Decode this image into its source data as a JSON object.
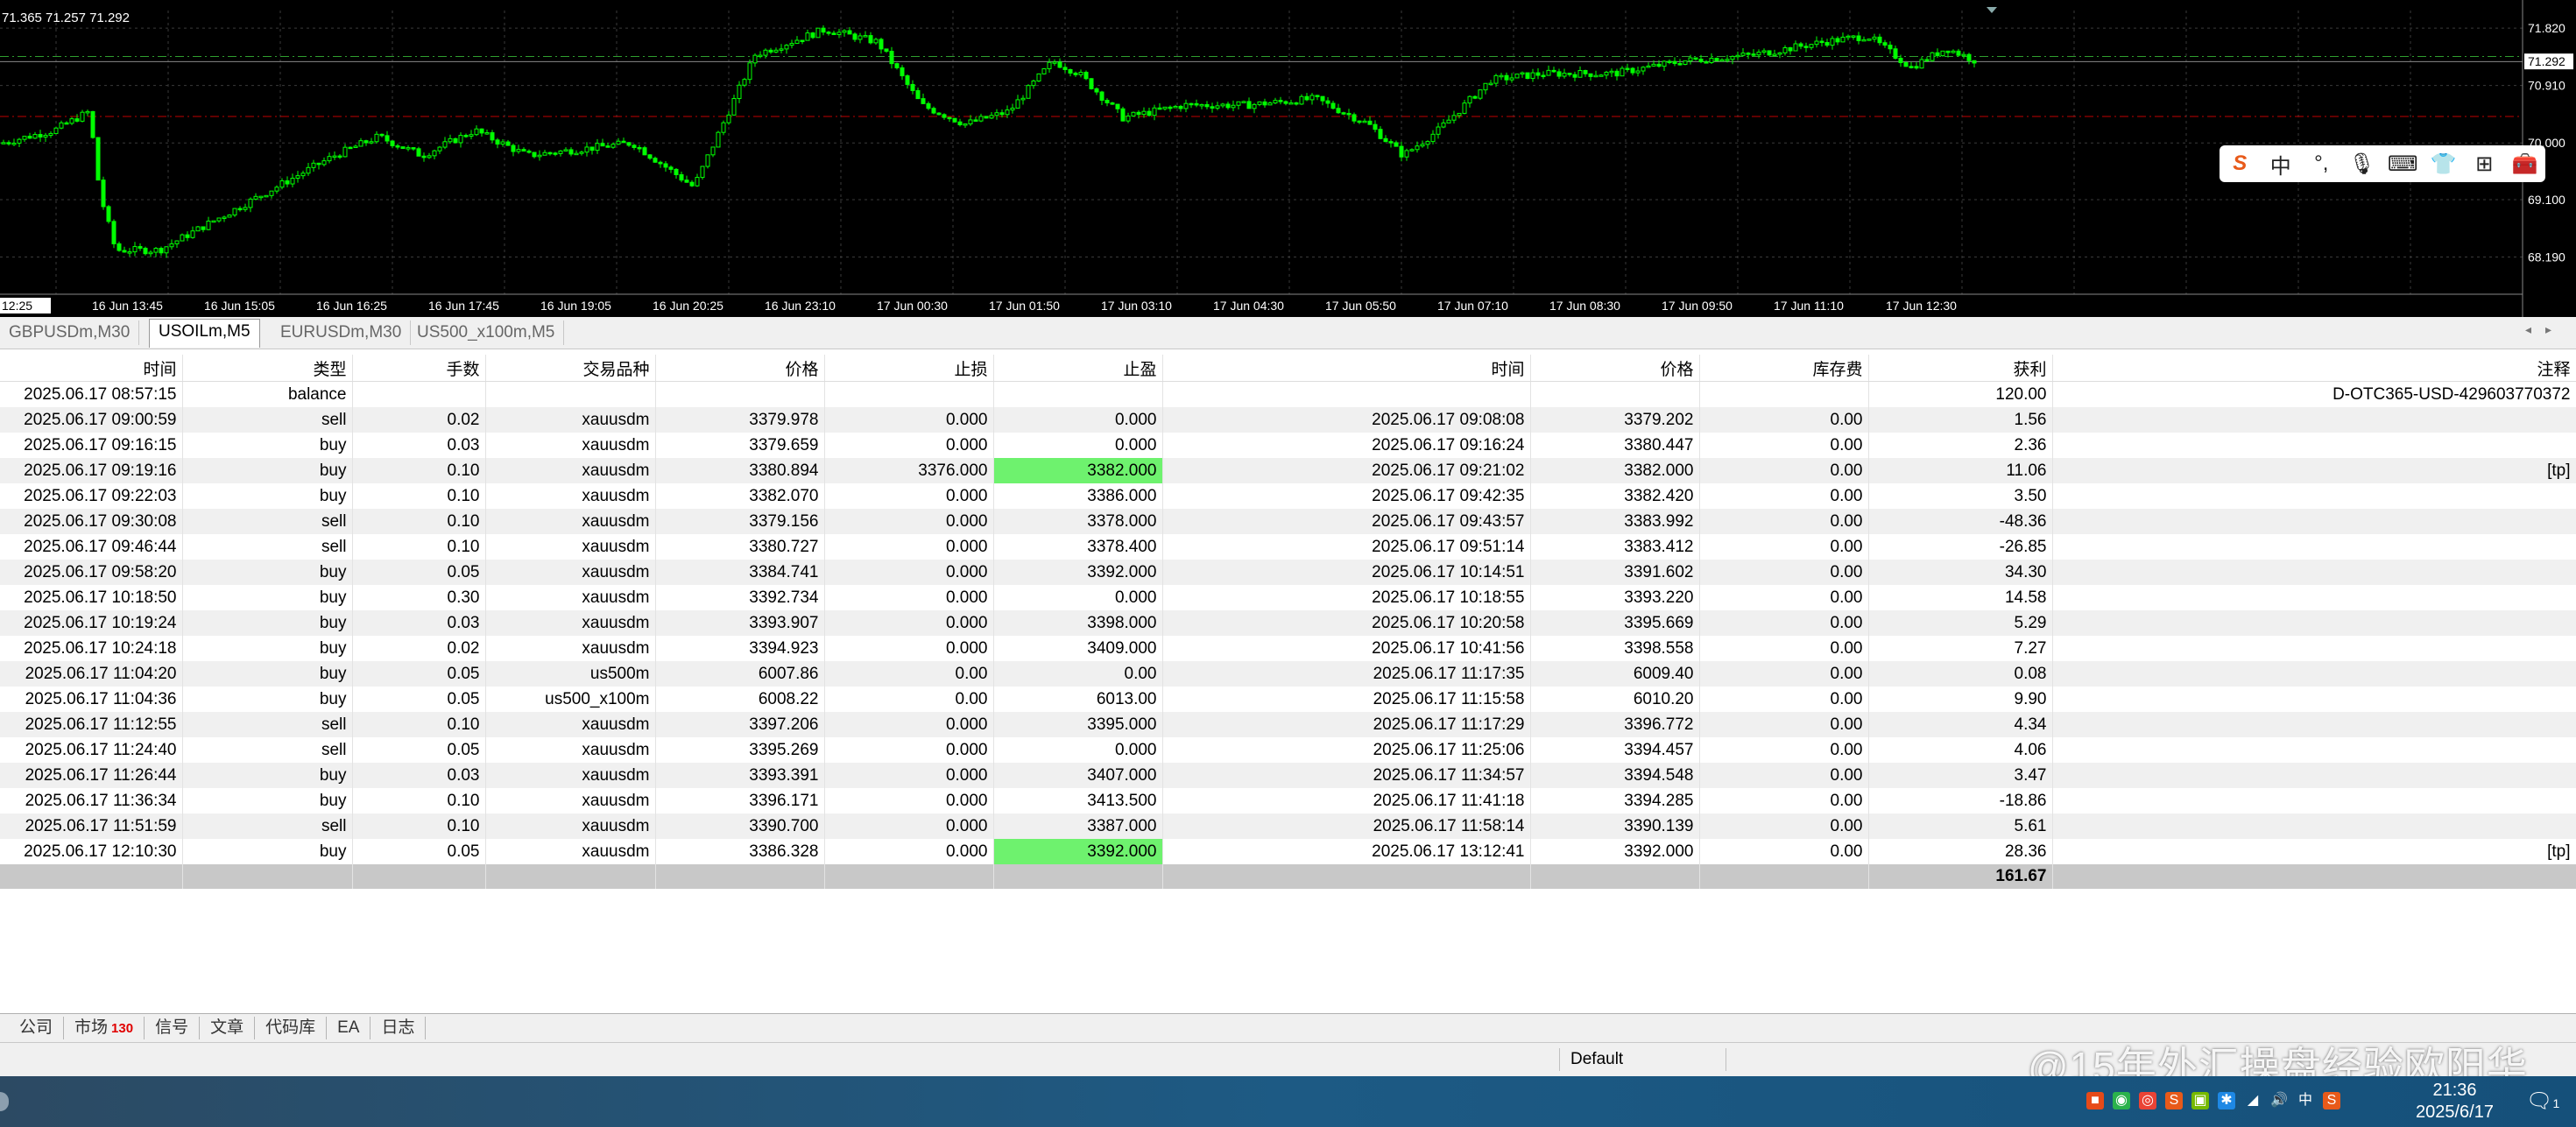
{
  "chart": {
    "corner_text": "71.365 71.257 71.292",
    "price_labels": [
      "71.820",
      "71.292",
      "70.910",
      "70.000",
      "69.100",
      "68.190"
    ],
    "time_labels": [
      "12:25",
      "16 Jun 13:45",
      "16 Jun 15:05",
      "16 Jun 16:25",
      "16 Jun 17:45",
      "16 Jun 19:05",
      "16 Jun 20:25",
      "16 Jun 23:10",
      "17 Jun 00:30",
      "17 Jun 01:50",
      "17 Jun 03:10",
      "17 Jun 04:30",
      "17 Jun 05:50",
      "17 Jun 07:10",
      "17 Jun 08:30",
      "17 Jun 09:50",
      "17 Jun 11:10",
      "17 Jun 12:30"
    ],
    "colors": {
      "background": "#000000",
      "candle": "#00ff00",
      "ask_line": "#3a7a3a",
      "red_level": "#c00000",
      "bid_label_bg": "#ffffff"
    }
  },
  "ime_toolbar": {
    "items": [
      {
        "icon": "sogou-logo-icon",
        "glyph": "S"
      },
      {
        "icon": "chinese-mode-icon",
        "glyph": "中"
      },
      {
        "icon": "punctuation-icon",
        "glyph": "°,"
      },
      {
        "icon": "microphone-icon",
        "glyph": "🎙"
      },
      {
        "icon": "keyboard-icon",
        "glyph": "⌨"
      },
      {
        "icon": "skin-icon",
        "glyph": "👕"
      },
      {
        "icon": "grid-icon",
        "glyph": "⊞"
      },
      {
        "icon": "toolbox-icon",
        "glyph": "🧰"
      }
    ]
  },
  "chart_tabs": [
    "GBPUSDm,M30",
    "USOILm,M5",
    "EURUSDm,M30",
    "US500_x100m,M5"
  ],
  "active_chart_tab": "USOILm,M5",
  "table": {
    "headers": [
      "时间",
      "类型",
      "手数",
      "交易品种",
      "价格",
      "止损",
      "止盈",
      "时间",
      "价格",
      "库存费",
      "获利",
      "注释"
    ],
    "rows": [
      [
        "2025.06.17 08:57:15",
        "balance",
        "",
        "",
        "",
        "",
        "",
        "",
        "",
        "",
        "120.00",
        "D-OTC365-USD-429603770372"
      ],
      [
        "2025.06.17 09:00:59",
        "sell",
        "0.02",
        "xauusdm",
        "3379.978",
        "0.000",
        "0.000",
        "2025.06.17 09:08:08",
        "3379.202",
        "0.00",
        "1.56",
        ""
      ],
      [
        "2025.06.17 09:16:15",
        "buy",
        "0.03",
        "xauusdm",
        "3379.659",
        "0.000",
        "0.000",
        "2025.06.17 09:16:24",
        "3380.447",
        "0.00",
        "2.36",
        ""
      ],
      [
        "2025.06.17 09:19:16",
        "buy",
        "0.10",
        "xauusdm",
        "3380.894",
        "3376.000",
        "3382.000",
        "2025.06.17 09:21:02",
        "3382.000",
        "0.00",
        "11.06",
        "[tp]"
      ],
      [
        "2025.06.17 09:22:03",
        "buy",
        "0.10",
        "xauusdm",
        "3382.070",
        "0.000",
        "3386.000",
        "2025.06.17 09:42:35",
        "3382.420",
        "0.00",
        "3.50",
        ""
      ],
      [
        "2025.06.17 09:30:08",
        "sell",
        "0.10",
        "xauusdm",
        "3379.156",
        "0.000",
        "3378.000",
        "2025.06.17 09:43:57",
        "3383.992",
        "0.00",
        "-48.36",
        ""
      ],
      [
        "2025.06.17 09:46:44",
        "sell",
        "0.10",
        "xauusdm",
        "3380.727",
        "0.000",
        "3378.400",
        "2025.06.17 09:51:14",
        "3383.412",
        "0.00",
        "-26.85",
        ""
      ],
      [
        "2025.06.17 09:58:20",
        "buy",
        "0.05",
        "xauusdm",
        "3384.741",
        "0.000",
        "3392.000",
        "2025.06.17 10:14:51",
        "3391.602",
        "0.00",
        "34.30",
        ""
      ],
      [
        "2025.06.17 10:18:50",
        "buy",
        "0.30",
        "xauusdm",
        "3392.734",
        "0.000",
        "0.000",
        "2025.06.17 10:18:55",
        "3393.220",
        "0.00",
        "14.58",
        ""
      ],
      [
        "2025.06.17 10:19:24",
        "buy",
        "0.03",
        "xauusdm",
        "3393.907",
        "0.000",
        "3398.000",
        "2025.06.17 10:20:58",
        "3395.669",
        "0.00",
        "5.29",
        ""
      ],
      [
        "2025.06.17 10:24:18",
        "buy",
        "0.02",
        "xauusdm",
        "3394.923",
        "0.000",
        "3409.000",
        "2025.06.17 10:41:56",
        "3398.558",
        "0.00",
        "7.27",
        ""
      ],
      [
        "2025.06.17 11:04:20",
        "buy",
        "0.05",
        "us500m",
        "6007.86",
        "0.00",
        "0.00",
        "2025.06.17 11:17:35",
        "6009.40",
        "0.00",
        "0.08",
        ""
      ],
      [
        "2025.06.17 11:04:36",
        "buy",
        "0.05",
        "us500_x100m",
        "6008.22",
        "0.00",
        "6013.00",
        "2025.06.17 11:15:58",
        "6010.20",
        "0.00",
        "9.90",
        ""
      ],
      [
        "2025.06.17 11:12:55",
        "sell",
        "0.10",
        "xauusdm",
        "3397.206",
        "0.000",
        "3395.000",
        "2025.06.17 11:17:29",
        "3396.772",
        "0.00",
        "4.34",
        ""
      ],
      [
        "2025.06.17 11:24:40",
        "sell",
        "0.05",
        "xauusdm",
        "3395.269",
        "0.000",
        "0.000",
        "2025.06.17 11:25:06",
        "3394.457",
        "0.00",
        "4.06",
        ""
      ],
      [
        "2025.06.17 11:26:44",
        "buy",
        "0.03",
        "xauusdm",
        "3393.391",
        "0.000",
        "3407.000",
        "2025.06.17 11:34:57",
        "3394.548",
        "0.00",
        "3.47",
        ""
      ],
      [
        "2025.06.17 11:36:34",
        "buy",
        "0.10",
        "xauusdm",
        "3396.171",
        "0.000",
        "3413.500",
        "2025.06.17 11:41:18",
        "3394.285",
        "0.00",
        "-18.86",
        ""
      ],
      [
        "2025.06.17 11:51:59",
        "sell",
        "0.10",
        "xauusdm",
        "3390.700",
        "0.000",
        "3387.000",
        "2025.06.17 11:58:14",
        "3390.139",
        "0.00",
        "5.61",
        ""
      ],
      [
        "2025.06.17 12:10:30",
        "buy",
        "0.05",
        "xauusdm",
        "3386.328",
        "0.000",
        "3392.000",
        "2025.06.17 13:12:41",
        "3392.000",
        "0.00",
        "28.36",
        "[tp]"
      ]
    ],
    "tp_highlight_rows": [
      3,
      18
    ],
    "total": "161.67"
  },
  "bottom_tabs": [
    {
      "label": "公司"
    },
    {
      "label": "市场",
      "badge": "130"
    },
    {
      "label": "信号"
    },
    {
      "label": "文章"
    },
    {
      "label": "代码库"
    },
    {
      "label": "EA"
    },
    {
      "label": "日志"
    }
  ],
  "status_bar": {
    "profile": "Default"
  },
  "watermark": "@15年外汇操盘经验欧阳华",
  "taskbar": {
    "time": "21:36",
    "date": "2025/6/17",
    "notification_count": "1",
    "tray_icons": [
      "app-icon",
      "wechat-icon",
      "chrome-icon",
      "sogou-icon",
      "nvidia-icon",
      "bluetooth-icon",
      "network-icon",
      "volume-icon",
      "ime-chinese-icon",
      "sogou-tray-icon"
    ],
    "ime_label": "中"
  }
}
